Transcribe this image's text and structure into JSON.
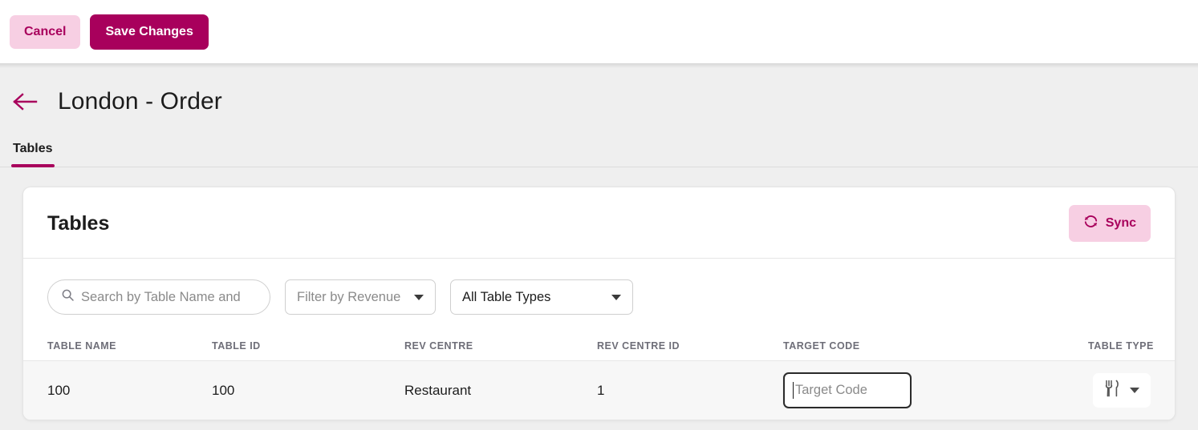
{
  "toolbar": {
    "cancel_label": "Cancel",
    "save_label": "Save Changes"
  },
  "header": {
    "back_icon": "arrow-left-icon",
    "title": "London - Order"
  },
  "tabs": [
    {
      "label": "Tables",
      "active": true
    }
  ],
  "card": {
    "title": "Tables",
    "sync_label": "Sync",
    "sync_icon": "refresh-icon"
  },
  "filters": {
    "search": {
      "icon": "search-icon",
      "placeholder": "Search by Table Name and"
    },
    "revenue": {
      "value": "Filter by Revenue",
      "is_placeholder": true
    },
    "table_types": {
      "value": "All Table Types",
      "is_placeholder": false
    }
  },
  "table": {
    "columns": [
      "TABLE NAME",
      "TABLE ID",
      "REV CENTRE",
      "REV CENTRE ID",
      "TARGET CODE",
      "TABLE TYPE"
    ],
    "rows": [
      {
        "table_name": "100",
        "table_id": "100",
        "rev_centre": "Restaurant",
        "rev_centre_id": "1",
        "target_code_value": "",
        "target_code_placeholder": "Target Code",
        "table_type_icon": "cutlery-icon"
      }
    ]
  },
  "colors": {
    "brand": "#a8005c",
    "brand_light": "#f7cfe3",
    "page_bg": "#efefef",
    "row_bg": "#f7f7f7",
    "muted_text": "#6e6e78"
  }
}
